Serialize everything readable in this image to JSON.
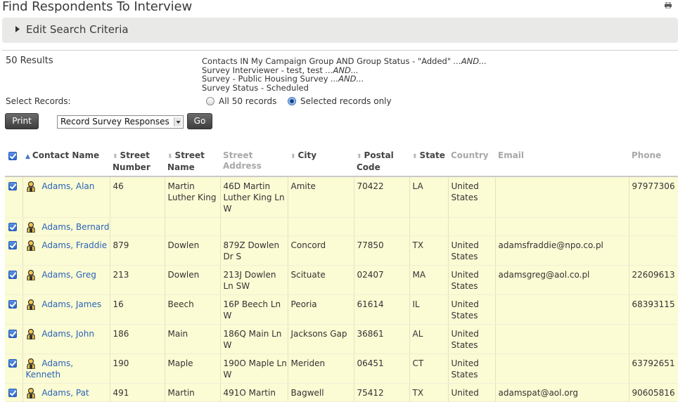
{
  "page": {
    "title": "Find Respondents To Interview"
  },
  "edit_panel": {
    "label": "Edit Search Criteria"
  },
  "results": {
    "count_label": "50 Results"
  },
  "criteria": [
    {
      "text": "Contacts IN My Campaign Group AND Group Status - \"Added\" ",
      "suffix": "...AND..."
    },
    {
      "text": "Survey Interviewer - test, test ",
      "suffix": "...AND..."
    },
    {
      "text": "Survey - Public Housing Survey ",
      "suffix": "...AND..."
    },
    {
      "text": "Survey Status - Scheduled",
      "suffix": ""
    }
  ],
  "select_records": {
    "label": "Select Records:",
    "all_label": "All 50 records",
    "selected_label": "Selected records only",
    "selected": "selected"
  },
  "actions": {
    "print_label": "Print",
    "action_select_value": "Record Survey Responses",
    "go_label": "Go"
  },
  "table": {
    "columns": [
      {
        "label": "Contact Name",
        "sortable": true
      },
      {
        "label": "Street Number",
        "sortable": true
      },
      {
        "label": "Street Name",
        "sortable": true
      },
      {
        "label": "Street Address",
        "sortable": false
      },
      {
        "label": "City",
        "sortable": true
      },
      {
        "label": "Postal Code",
        "sortable": true
      },
      {
        "label": "State",
        "sortable": true
      },
      {
        "label": "Country",
        "sortable": false
      },
      {
        "label": "Email",
        "sortable": false
      },
      {
        "label": "Phone",
        "sortable": false
      }
    ],
    "rows": [
      {
        "checked": true,
        "name": "Adams, Alan",
        "number": "46",
        "street": "Martin Luther King",
        "address": "46D Martin Luther King Ln W",
        "city": "Amite",
        "postal": "70422",
        "state": "LA",
        "country": "United States",
        "email": "",
        "phone": "97977306"
      },
      {
        "checked": true,
        "name": "Adams, Bernard",
        "number": "",
        "street": "",
        "address": "",
        "city": "",
        "postal": "",
        "state": "",
        "country": "",
        "email": "",
        "phone": ""
      },
      {
        "checked": true,
        "name": "Adams, Fraddie",
        "number": "879",
        "street": "Dowlen",
        "address": "879Z Dowlen Dr S",
        "city": "Concord",
        "postal": "77850",
        "state": "TX",
        "country": "United States",
        "email": "adamsfraddie@npo.co.pl",
        "phone": ""
      },
      {
        "checked": true,
        "name": "Adams, Greg",
        "number": "213",
        "street": "Dowlen",
        "address": "213J Dowlen Ln SW",
        "city": "Scituate",
        "postal": "02407",
        "state": "MA",
        "country": "United States",
        "email": "adamsgreg@aol.co.pl",
        "phone": "22609613"
      },
      {
        "checked": true,
        "name": "Adams, James",
        "number": "16",
        "street": "Beech",
        "address": "16P Beech Ln W",
        "city": "Peoria",
        "postal": "61614",
        "state": "IL",
        "country": "United States",
        "email": "",
        "phone": "68393115"
      },
      {
        "checked": true,
        "name": "Adams, John",
        "number": "186",
        "street": "Main",
        "address": "186Q Main Ln W",
        "city": "Jacksons Gap",
        "postal": "36861",
        "state": "AL",
        "country": "United States",
        "email": "",
        "phone": ""
      },
      {
        "checked": true,
        "name": "Adams, Kenneth",
        "number": "190",
        "street": "Maple",
        "address": "190O Maple Ln W",
        "city": "Meriden",
        "postal": "06451",
        "state": "CT",
        "country": "United States",
        "email": "",
        "phone": "63792651"
      },
      {
        "checked": true,
        "name": "Adams, Pat",
        "number": "491",
        "street": "Martin",
        "address": "491O Martin",
        "city": "Bagwell",
        "postal": "75412",
        "state": "TX",
        "country": "United",
        "email": "adamspat@aol.org",
        "phone": "90605816"
      }
    ]
  }
}
